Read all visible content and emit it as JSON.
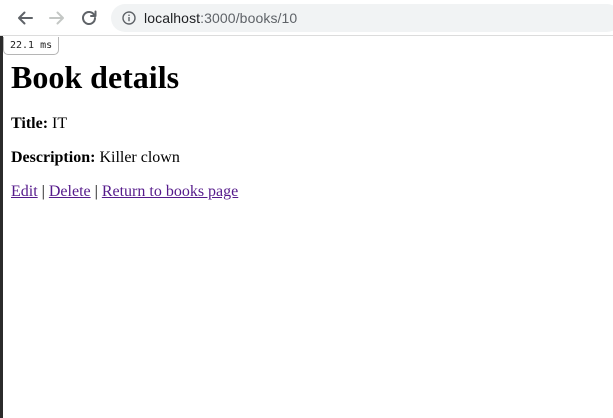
{
  "browser": {
    "url_host": "localhost",
    "url_path": ":3000/books/10",
    "icons": {
      "back": "back-arrow-icon",
      "forward": "forward-arrow-icon",
      "reload": "reload-icon",
      "site_info": "info-icon"
    }
  },
  "timer": {
    "label": "22.1 ms"
  },
  "page": {
    "heading": "Book details",
    "title_label": "Title:",
    "title_value": "IT",
    "description_label": "Description:",
    "description_value": "Killer clown",
    "links": {
      "edit": "Edit",
      "separator_1": "|",
      "delete": "Delete",
      "separator_2": "|",
      "return": "Return to books page"
    },
    "colors": {
      "visited_link": "#551a8b"
    }
  }
}
